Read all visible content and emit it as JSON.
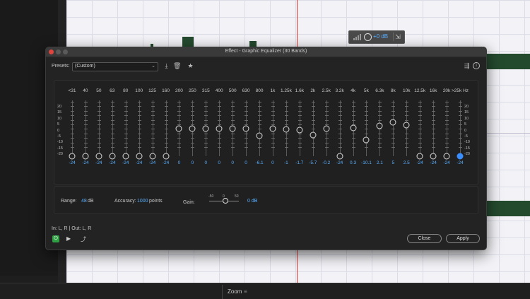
{
  "window": {
    "title": "Effect - Graphic Equalizer (30 Bands)"
  },
  "hud": {
    "gain": "+0 dB"
  },
  "presets": {
    "label": "Presets:",
    "value": "(Custom)"
  },
  "scale_labels": [
    "20",
    "15",
    "10",
    "5",
    "0",
    "-5",
    "-10",
    "-15",
    "-20"
  ],
  "bands": [
    {
      "freq": "<31",
      "gain": "-24",
      "db": -24
    },
    {
      "freq": "40",
      "gain": "-24",
      "db": -24
    },
    {
      "freq": "50",
      "gain": "-24",
      "db": -24
    },
    {
      "freq": "63",
      "gain": "-24",
      "db": -24
    },
    {
      "freq": "80",
      "gain": "-24",
      "db": -24
    },
    {
      "freq": "100",
      "gain": "-24",
      "db": -24
    },
    {
      "freq": "125",
      "gain": "-24",
      "db": -24
    },
    {
      "freq": "160",
      "gain": "-24",
      "db": -24
    },
    {
      "freq": "200",
      "gain": "0",
      "db": 0
    },
    {
      "freq": "250",
      "gain": "0",
      "db": 0
    },
    {
      "freq": "315",
      "gain": "0",
      "db": 0
    },
    {
      "freq": "400",
      "gain": "0",
      "db": 0
    },
    {
      "freq": "500",
      "gain": "0",
      "db": 0
    },
    {
      "freq": "630",
      "gain": "0",
      "db": 0
    },
    {
      "freq": "800",
      "gain": "-6.1",
      "db": -6.1
    },
    {
      "freq": "1k",
      "gain": "0",
      "db": 0
    },
    {
      "freq": "1.25k",
      "gain": "-1",
      "db": -1
    },
    {
      "freq": "1.6k",
      "gain": "-1.7",
      "db": -1.7
    },
    {
      "freq": "2k",
      "gain": "-5.7",
      "db": -5.7
    },
    {
      "freq": "2.5k",
      "gain": "-0.2",
      "db": -0.2
    },
    {
      "freq": "3.2k",
      "gain": "-24",
      "db": -24
    },
    {
      "freq": "4k",
      "gain": "0.3",
      "db": 0.3
    },
    {
      "freq": "5k",
      "gain": "-10.1",
      "db": -10.1
    },
    {
      "freq": "6.3k",
      "gain": "2.1",
      "db": 2.1
    },
    {
      "freq": "8k",
      "gain": "5",
      "db": 5
    },
    {
      "freq": "10k",
      "gain": "2.5",
      "db": 2.5
    },
    {
      "freq": "12.5k",
      "gain": "-24",
      "db": -24
    },
    {
      "freq": "16k",
      "gain": "-24",
      "db": -24
    },
    {
      "freq": "20k",
      "gain": "-24",
      "db": -24
    },
    {
      "freq": ">25k Hz",
      "gain": "-24",
      "db": -24,
      "selected": true
    }
  ],
  "options": {
    "range_label": "Range:",
    "range_value": "48",
    "range_unit": "dB",
    "accuracy_label": "Accuracy:",
    "accuracy_value": "1000",
    "accuracy_unit": "points",
    "gain_label": "Gain:",
    "gain_scale": [
      "-50",
      "0",
      "50"
    ],
    "gain_value": "0 dB",
    "gain": 0
  },
  "io": "In: L, R | Out: L, R",
  "buttons": {
    "close": "Close",
    "apply": "Apply"
  },
  "panel": {
    "zoom": "Zoom"
  },
  "colors": {
    "accent": "#3a8dff",
    "value_text": "#5ab0ff",
    "power_on": "#2ea043",
    "playhead": "#e0332b"
  }
}
